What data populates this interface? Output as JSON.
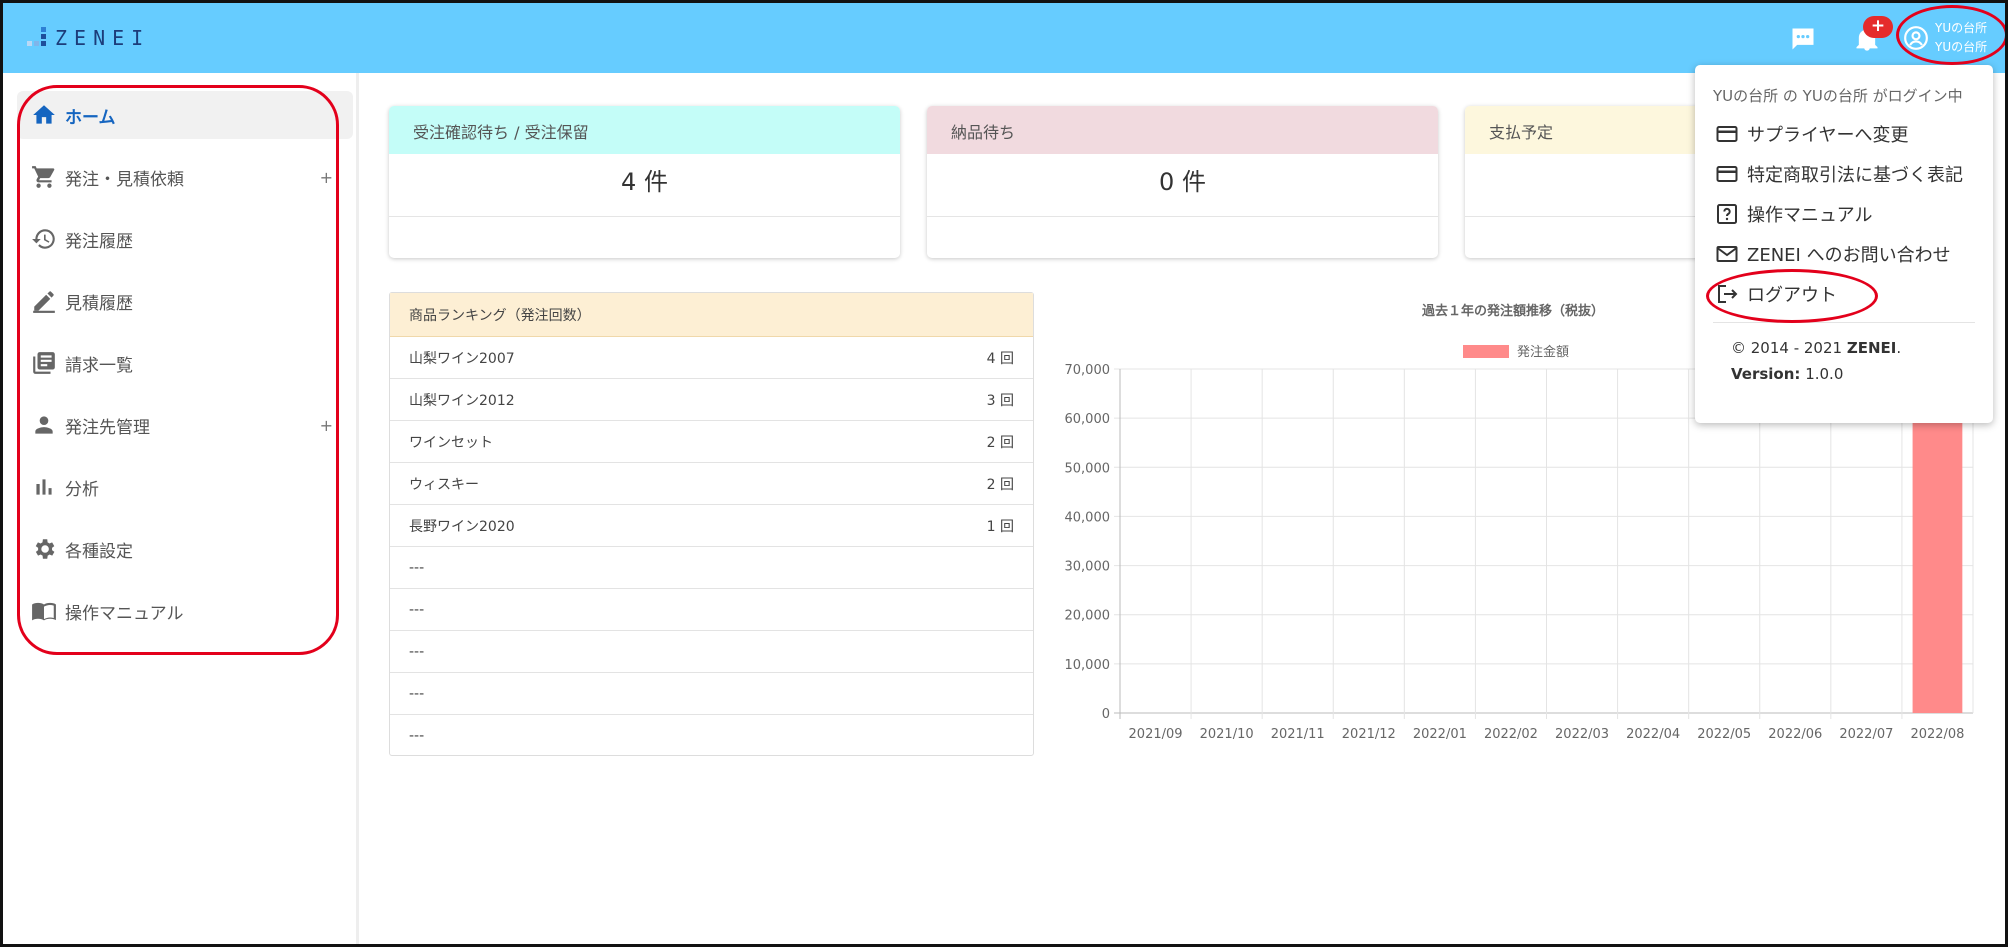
{
  "header": {
    "logo_text": "ZENEI",
    "badge": "+",
    "user_line1": "YUの台所",
    "user_line2": "YUの台所"
  },
  "sidebar": {
    "items": [
      {
        "label": "ホーム",
        "icon": "home-icon",
        "active": true
      },
      {
        "label": "発注・見積依頼",
        "icon": "cart-icon",
        "expand": "+"
      },
      {
        "label": "発注履歴",
        "icon": "history-icon"
      },
      {
        "label": "見積履歴",
        "icon": "pencil-icon"
      },
      {
        "label": "請求一覧",
        "icon": "list-icon"
      },
      {
        "label": "発注先管理",
        "icon": "person-icon",
        "expand": "+"
      },
      {
        "label": "分析",
        "icon": "bar-chart-icon"
      },
      {
        "label": "各種設定",
        "icon": "gear-icon"
      },
      {
        "label": "操作マニュアル",
        "icon": "book-icon"
      }
    ]
  },
  "cards": [
    {
      "title": "受注確認待ち / 受注保留",
      "value": "4 件",
      "color": "#c4fdf8"
    },
    {
      "title": "納品待ち",
      "value": "0 件",
      "color": "#f1dadf"
    },
    {
      "title": "支払予定",
      "value": "",
      "color": "#fdf7dd"
    }
  ],
  "ranking": {
    "title": "商品ランキング（発注回数）",
    "rows": [
      {
        "name": "山梨ワイン2007",
        "count": "4 回"
      },
      {
        "name": "山梨ワイン2012",
        "count": "3 回"
      },
      {
        "name": "ワインセット",
        "count": "2 回"
      },
      {
        "name": "ウィスキー",
        "count": "2 回"
      },
      {
        "name": "長野ワイン2020",
        "count": "1 回"
      },
      {
        "name": "---",
        "count": ""
      },
      {
        "name": "---",
        "count": ""
      },
      {
        "name": "---",
        "count": ""
      },
      {
        "name": "---",
        "count": ""
      },
      {
        "name": "---",
        "count": ""
      }
    ]
  },
  "chart_data": {
    "type": "bar",
    "title": "過去１年の発注額推移（税抜）",
    "categories": [
      "2021/09",
      "2021/10",
      "2021/11",
      "2021/12",
      "2022/01",
      "2022/02",
      "2022/03",
      "2022/04",
      "2022/05",
      "2022/06",
      "2022/07",
      "2022/08"
    ],
    "series": [
      {
        "name": "発注金額",
        "values": [
          0,
          0,
          0,
          0,
          0,
          0,
          0,
          0,
          0,
          0,
          0,
          60000
        ]
      }
    ],
    "yticks": [
      "0",
      "10,000",
      "20,000",
      "30,000",
      "40,000",
      "50,000",
      "60,000",
      "70,000"
    ],
    "ylim": [
      0,
      70000
    ],
    "grid": true,
    "legend": "top",
    "bar_color": "#ff8a8a"
  },
  "dropdown": {
    "login_text": "YUの台所 の YUの台所 がログイン中",
    "items": [
      {
        "label": "サプライヤーへ変更",
        "icon": "card-icon"
      },
      {
        "label": "特定商取引法に基づく表記",
        "icon": "card-icon"
      },
      {
        "label": "操作マニュアル",
        "icon": "help-icon"
      },
      {
        "label": "ZENEI へのお問い合わせ",
        "icon": "mail-icon"
      },
      {
        "label": "ログアウト",
        "icon": "logout-icon"
      }
    ],
    "copyright_prefix": "© 2014 - 2021 ",
    "copyright_brand": "ZENEI",
    "copyright_suffix": ".",
    "version_label": "Version:",
    "version_value": " 1.0.0"
  }
}
